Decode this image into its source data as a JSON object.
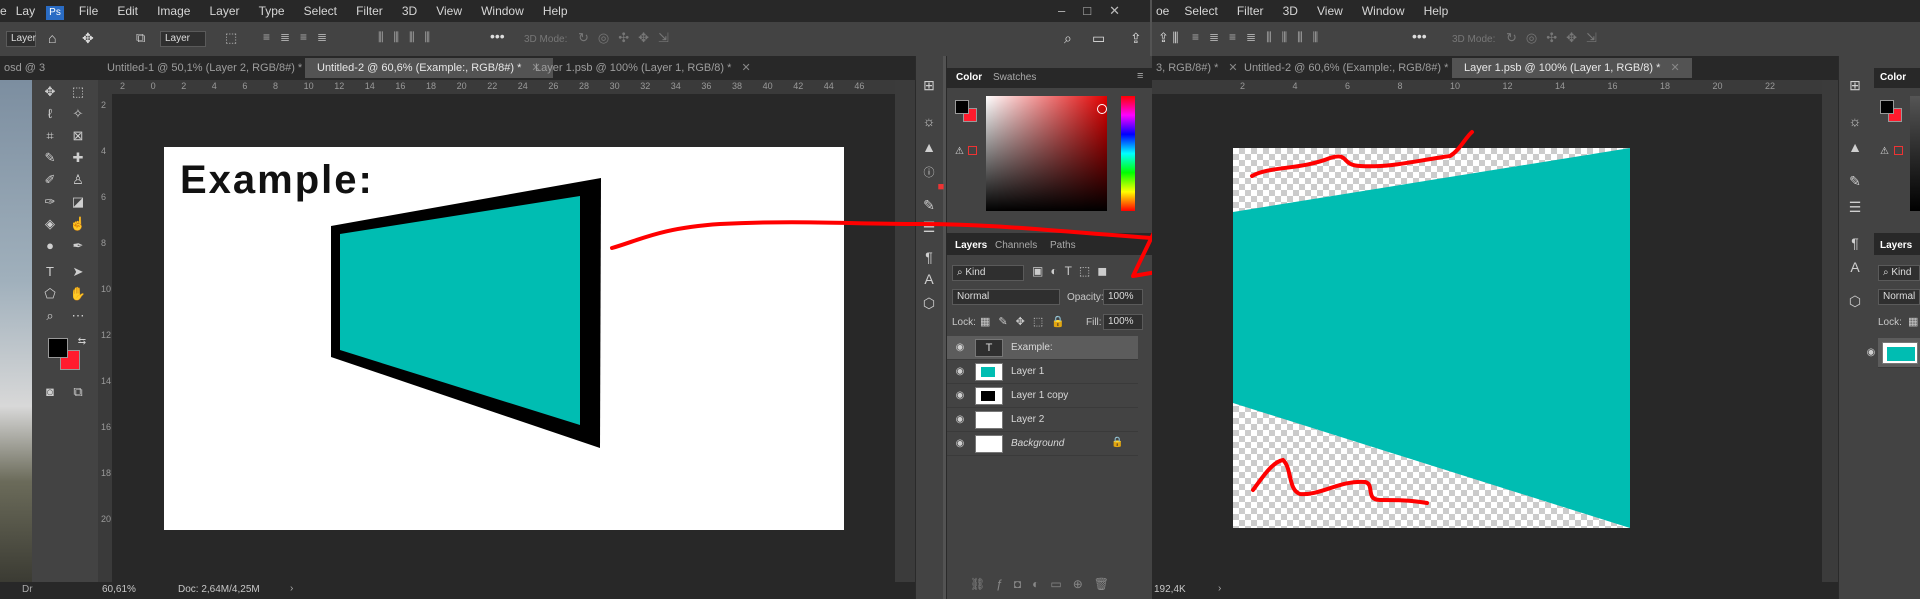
{
  "left_window": {
    "menu": [
      "File",
      "Edit",
      "Image",
      "Layer",
      "Type",
      "Select",
      "Filter",
      "3D",
      "View",
      "Window",
      "Help"
    ],
    "menu_partial": [
      "e",
      "Lay"
    ],
    "options": {
      "tool_select": "Layer",
      "auto_select": "Layer",
      "mode_3d": "3D Mode:"
    },
    "tabs": [
      {
        "label": "osd @ 3",
        "active": false
      },
      {
        "label": "Untitled-1 @ 50,1% (Layer 2, RGB/8#) *",
        "active": false
      },
      {
        "label": "Untitled-2 @ 60,6% (Example:, RGB/8#) *",
        "active": true
      },
      {
        "label": "Layer 1.psb @ 100% (Layer 1, RGB/8) *",
        "active": false
      }
    ],
    "ruler_h": [
      "2",
      "0",
      "2",
      "4",
      "6",
      "8",
      "10",
      "12",
      "14",
      "16",
      "18",
      "20",
      "22",
      "24",
      "26",
      "28",
      "30",
      "32",
      "34",
      "36",
      "38",
      "40",
      "42",
      "44",
      "46"
    ],
    "ruler_v": [
      "2",
      "4",
      "6",
      "8",
      "10",
      "12",
      "14",
      "16",
      "18",
      "20"
    ],
    "canvas_text": "Example:",
    "status": {
      "zoom": "60,61%",
      "doc": "Doc: 2,64M/4,25M",
      "left_partial": "Dr"
    }
  },
  "color_panel": {
    "tabs": [
      "Color",
      "Swatches"
    ]
  },
  "layers_panel": {
    "tabs": [
      "Layers",
      "Channels",
      "Paths"
    ],
    "kind_label": "Kind",
    "blend_mode": "Normal",
    "opacity_label": "Opacity:",
    "opacity_value": "100%",
    "lock_label": "Lock:",
    "fill_label": "Fill:",
    "fill_value": "100%",
    "layers": [
      {
        "name": "Example:",
        "type": "text",
        "selected": true
      },
      {
        "name": "Layer 1",
        "type": "image",
        "selected": false
      },
      {
        "name": "Layer 1 copy",
        "type": "image",
        "selected": false
      },
      {
        "name": "Layer 2",
        "type": "transparent",
        "selected": false
      },
      {
        "name": "Background",
        "type": "background",
        "selected": false,
        "locked": true
      }
    ]
  },
  "right_window": {
    "menu": [
      "Select",
      "Filter",
      "3D",
      "View",
      "Window",
      "Help"
    ],
    "menu_partial": "oe",
    "mode_3d": "3D Mode:",
    "tabs": [
      {
        "label": "3, RGB/8#) *",
        "active": false
      },
      {
        "label": "Untitled-2 @ 60,6% (Example:, RGB/8#) *",
        "active": false
      },
      {
        "label": "Layer 1.psb @ 100% (Layer 1, RGB/8) *",
        "active": true
      }
    ],
    "ruler_h": [
      "2",
      "4",
      "6",
      "8",
      "10",
      "12",
      "14",
      "16",
      "18",
      "20",
      "22"
    ],
    "status": "192,4K",
    "color_tab": "Color",
    "layers_tab": "Layers",
    "kind_label": "Kind",
    "blend_mode": "Normal",
    "lock_label": "Lock:"
  },
  "colors": {
    "teal": "#00bdb2",
    "annotation_red": "#ff0000",
    "foreground": "#000000",
    "background": "#ff1b2d"
  }
}
